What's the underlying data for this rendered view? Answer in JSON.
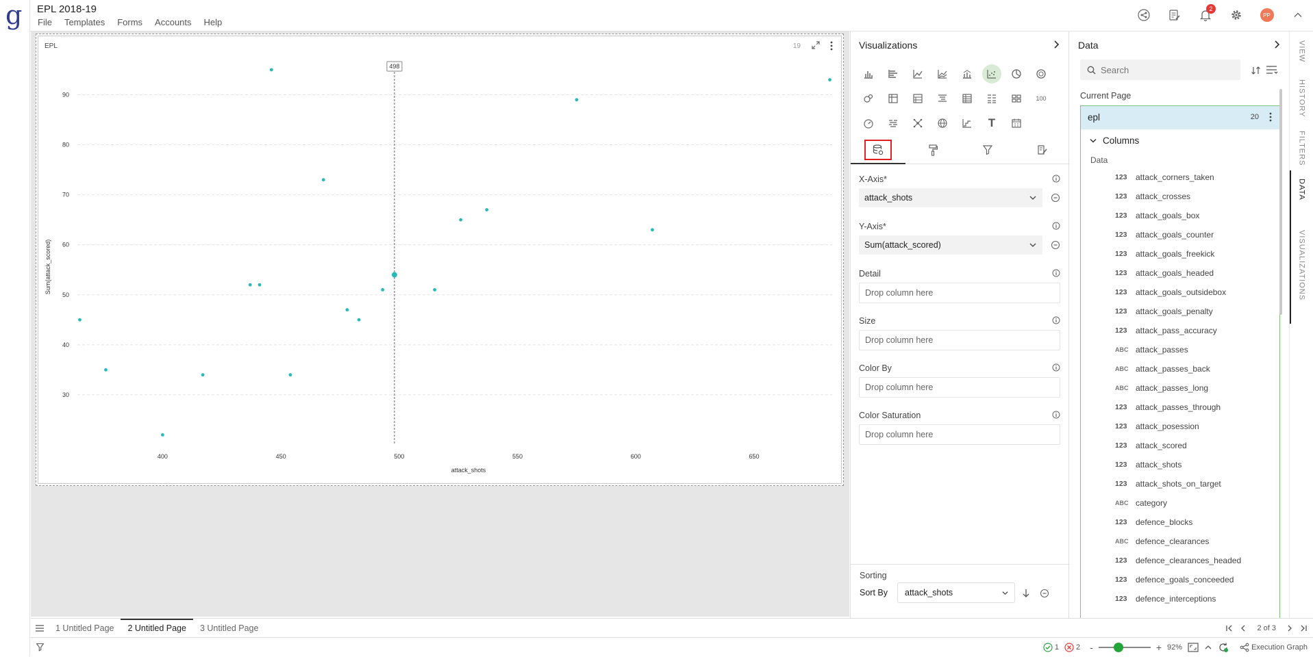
{
  "app": {
    "logo": "g",
    "title": "EPL 2018-19",
    "menu": [
      "File",
      "Templates",
      "Forms",
      "Accounts",
      "Help"
    ],
    "notification_count": "2",
    "avatar_initials": "PP"
  },
  "card": {
    "title": "EPL",
    "count": "19",
    "hover_label": "498"
  },
  "chart_data": {
    "type": "scatter",
    "xlabel": "attack_shots",
    "ylabel": "Sum(attack_scored)",
    "x_ticks": [
      400,
      450,
      500,
      550,
      600,
      650
    ],
    "y_ticks": [
      30,
      40,
      50,
      60,
      70,
      80,
      90
    ],
    "xlim": [
      364,
      683
    ],
    "ylim": [
      20,
      98
    ],
    "point_color": "#2ab9b9",
    "hover_x": 498,
    "points": [
      {
        "x": 365,
        "y": 45
      },
      {
        "x": 376,
        "y": 35
      },
      {
        "x": 400,
        "y": 22
      },
      {
        "x": 417,
        "y": 34
      },
      {
        "x": 437,
        "y": 52
      },
      {
        "x": 441,
        "y": 52
      },
      {
        "x": 446,
        "y": 95
      },
      {
        "x": 454,
        "y": 34
      },
      {
        "x": 468,
        "y": 73
      },
      {
        "x": 478,
        "y": 47
      },
      {
        "x": 483,
        "y": 45
      },
      {
        "x": 493,
        "y": 51
      },
      {
        "x": 498,
        "y": 54,
        "highlight": true
      },
      {
        "x": 515,
        "y": 51
      },
      {
        "x": 526,
        "y": 65
      },
      {
        "x": 537,
        "y": 67
      },
      {
        "x": 575,
        "y": 89
      },
      {
        "x": 607,
        "y": 63
      },
      {
        "x": 682,
        "y": 93
      }
    ]
  },
  "visualizations": {
    "title": "Visualizations",
    "number_tile": "100",
    "text_tile": "T",
    "x_axis": {
      "label": "X-Axis*",
      "value": "attack_shots"
    },
    "y_axis": {
      "label": "Y-Axis*",
      "value": "Sum(attack_scored)"
    },
    "detail": {
      "label": "Detail",
      "placeholder": "Drop column here"
    },
    "size": {
      "label": "Size",
      "placeholder": "Drop column here"
    },
    "color_by": {
      "label": "Color By",
      "placeholder": "Drop column here"
    },
    "color_saturation": {
      "label": "Color Saturation",
      "placeholder": "Drop column here"
    },
    "sorting": {
      "label": "Sorting",
      "sort_by_label": "Sort By",
      "sort_by_value": "attack_shots"
    }
  },
  "data_panel": {
    "title": "Data",
    "search_placeholder": "Search",
    "current_page_label": "Current Page",
    "dataset": {
      "name": "epl",
      "count": "20"
    },
    "columns_label": "Columns",
    "group_label": "Data",
    "columns": [
      {
        "type": "123",
        "name": "attack_corners_taken"
      },
      {
        "type": "123",
        "name": "attack_crosses"
      },
      {
        "type": "123",
        "name": "attack_goals_box"
      },
      {
        "type": "123",
        "name": "attack_goals_counter"
      },
      {
        "type": "123",
        "name": "attack_goals_freekick"
      },
      {
        "type": "123",
        "name": "attack_goals_headed"
      },
      {
        "type": "123",
        "name": "attack_goals_outsidebox"
      },
      {
        "type": "123",
        "name": "attack_goals_penalty"
      },
      {
        "type": "123",
        "name": "attack_pass_accuracy"
      },
      {
        "type": "ABC",
        "name": "attack_passes"
      },
      {
        "type": "ABC",
        "name": "attack_passes_back"
      },
      {
        "type": "ABC",
        "name": "attack_passes_long"
      },
      {
        "type": "123",
        "name": "attack_passes_through"
      },
      {
        "type": "123",
        "name": "attack_posession"
      },
      {
        "type": "123",
        "name": "attack_scored"
      },
      {
        "type": "123",
        "name": "attack_shots"
      },
      {
        "type": "123",
        "name": "attack_shots_on_target"
      },
      {
        "type": "ABC",
        "name": "category"
      },
      {
        "type": "123",
        "name": "defence_blocks"
      },
      {
        "type": "ABC",
        "name": "defence_clearances"
      },
      {
        "type": "123",
        "name": "defence_clearances_headed"
      },
      {
        "type": "123",
        "name": "defence_goals_conceeded"
      },
      {
        "type": "123",
        "name": "defence_interceptions"
      }
    ]
  },
  "side_tabs": [
    "VIEW",
    "HISTORY",
    "FILTERS",
    "DATA",
    "VISUALIZATIONS"
  ],
  "active_side_tab": "DATA",
  "pages": [
    "1 Untitled Page",
    "2 Untitled Page",
    "3 Untitled Page"
  ],
  "active_page": 1,
  "pager": {
    "text": "2 of 3"
  },
  "status": {
    "ok_count": "1",
    "error_count": "2",
    "zoom_minus": "-",
    "zoom_plus": "+",
    "zoom_level": "92%",
    "zoom_fraction": 0.38,
    "execution_graph": "Execution Graph"
  },
  "colors": {
    "accent": "#2ab9b9",
    "brand": "#2f3b8f",
    "selected_tab_box": "#e02020",
    "dataset_border": "#7dc47c"
  }
}
